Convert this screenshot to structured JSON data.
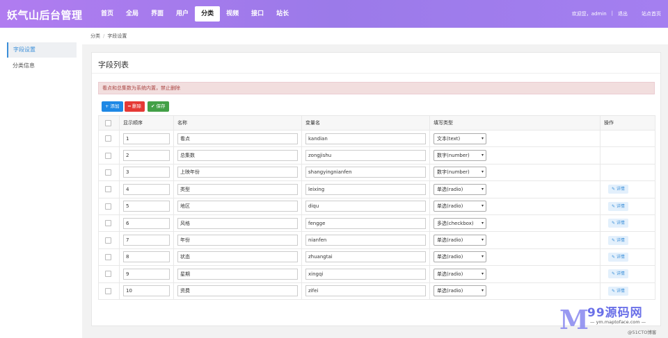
{
  "header": {
    "brand": "妖气山后台管理",
    "nav": [
      "首页",
      "全局",
      "界面",
      "用户",
      "分类",
      "视频",
      "接口",
      "站长"
    ],
    "active_nav": 4,
    "welcome": "欢迎您，admin",
    "separator": "|",
    "logout": "退出",
    "home_link": "站点首页"
  },
  "sidebar": {
    "items": [
      {
        "label": "字段设置",
        "active": true
      },
      {
        "label": "分类信息",
        "active": false
      }
    ]
  },
  "breadcrumb": {
    "root": "分类",
    "slash": "/",
    "current": "字段设置"
  },
  "panel": {
    "title": "字段列表",
    "alert": "看点和总集数为系统内置，禁止删除",
    "buttons": {
      "add": "+ 添加",
      "delete": "━ 删除",
      "save": "✔ 保存"
    }
  },
  "table": {
    "headers": [
      "",
      "显示顺序",
      "名称",
      "变量名",
      "填写类型",
      "操作"
    ],
    "rows": [
      {
        "order": "1",
        "name": "看点",
        "var": "kandian",
        "type": "文本(text)",
        "detail": ""
      },
      {
        "order": "2",
        "name": "总集数",
        "var": "zongjishu",
        "type": "数字(number)",
        "detail": ""
      },
      {
        "order": "3",
        "name": "上映年份",
        "var": "shangyingnianfen",
        "type": "数字(number)",
        "detail": ""
      },
      {
        "order": "4",
        "name": "类型",
        "var": "leixing",
        "type": "单选(radio)",
        "detail": "✎ 详情"
      },
      {
        "order": "5",
        "name": "地区",
        "var": "diqu",
        "type": "单选(radio)",
        "detail": "✎ 详情"
      },
      {
        "order": "6",
        "name": "风格",
        "var": "fengge",
        "type": "多选(checkbox)",
        "detail": "✎ 详情"
      },
      {
        "order": "7",
        "name": "年份",
        "var": "nianfen",
        "type": "单选(radio)",
        "detail": "✎ 详情"
      },
      {
        "order": "8",
        "name": "状态",
        "var": "zhuangtai",
        "type": "单选(radio)",
        "detail": "✎ 详情"
      },
      {
        "order": "9",
        "name": "星期",
        "var": "xingqi",
        "type": "单选(radio)",
        "detail": "✎ 详情"
      },
      {
        "order": "10",
        "name": "资费",
        "var": "zifei",
        "type": "单选(radio)",
        "detail": "✎ 详情"
      }
    ]
  },
  "watermark": {
    "logo": "M",
    "brand": "99源码网",
    "url": "— ym.maptoface.com —",
    "tag": "@51CTO博客"
  }
}
